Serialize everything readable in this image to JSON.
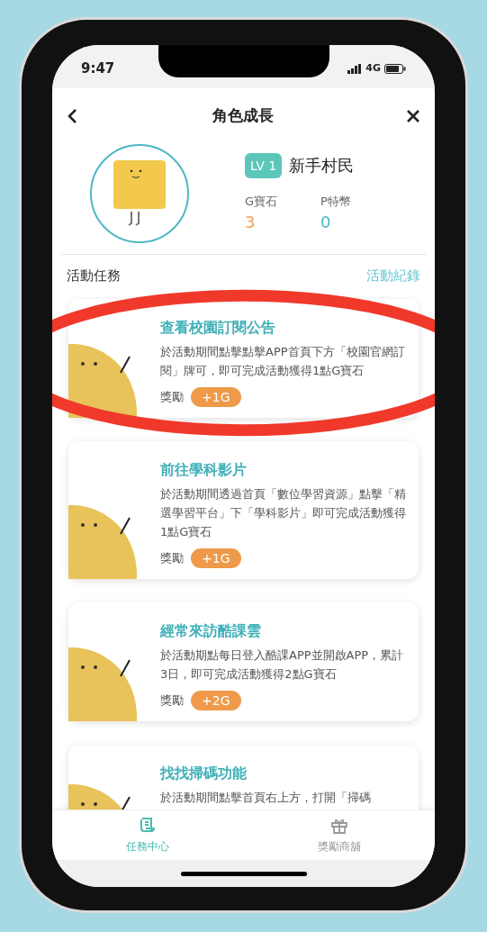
{
  "status_bar": {
    "time": "9:47",
    "network": "4G"
  },
  "header": {
    "title": "角色成長"
  },
  "profile": {
    "level_badge": "LV 1",
    "rank": "新手村民",
    "stats": [
      {
        "label": "G寶石",
        "value": "3",
        "color": "#f0a050"
      },
      {
        "label": "P特幣",
        "value": "0",
        "color": "#4bb8c4"
      }
    ]
  },
  "section": {
    "title": "活動任務",
    "link": "活動紀錄"
  },
  "tasks": [
    {
      "title": "查看校園訂閱公告",
      "description": "於活動期間點擊點擊APP首頁下方「校園官網訂閱」牌可，即可完成活動獲得1點G寶石",
      "reward_label": "獎勵",
      "reward": "+1G",
      "highlighted": true
    },
    {
      "title": "前往學科影片",
      "description": "於活動期間透過首頁「數位學習資源」點擊「精選學習平台」下「學科影片」即可完成活動獲得1點G寶石",
      "reward_label": "獎勵",
      "reward": "+1G",
      "highlighted": false
    },
    {
      "title": "經常來訪酷課雲",
      "description": "於活動期點每日登入酷課APP並開啟APP，累計3日，即可完成活動獲得2點G寶石",
      "reward_label": "獎勵",
      "reward": "+2G",
      "highlighted": false
    },
    {
      "title": "找找掃碼功能",
      "description": "於活動期間點擊首頁右上方，打開「掃碼",
      "highlighted": false
    }
  ],
  "tab_bar": [
    {
      "label": "任務中心",
      "selected": true
    },
    {
      "label": "獎勵商舖",
      "selected": false
    }
  ]
}
